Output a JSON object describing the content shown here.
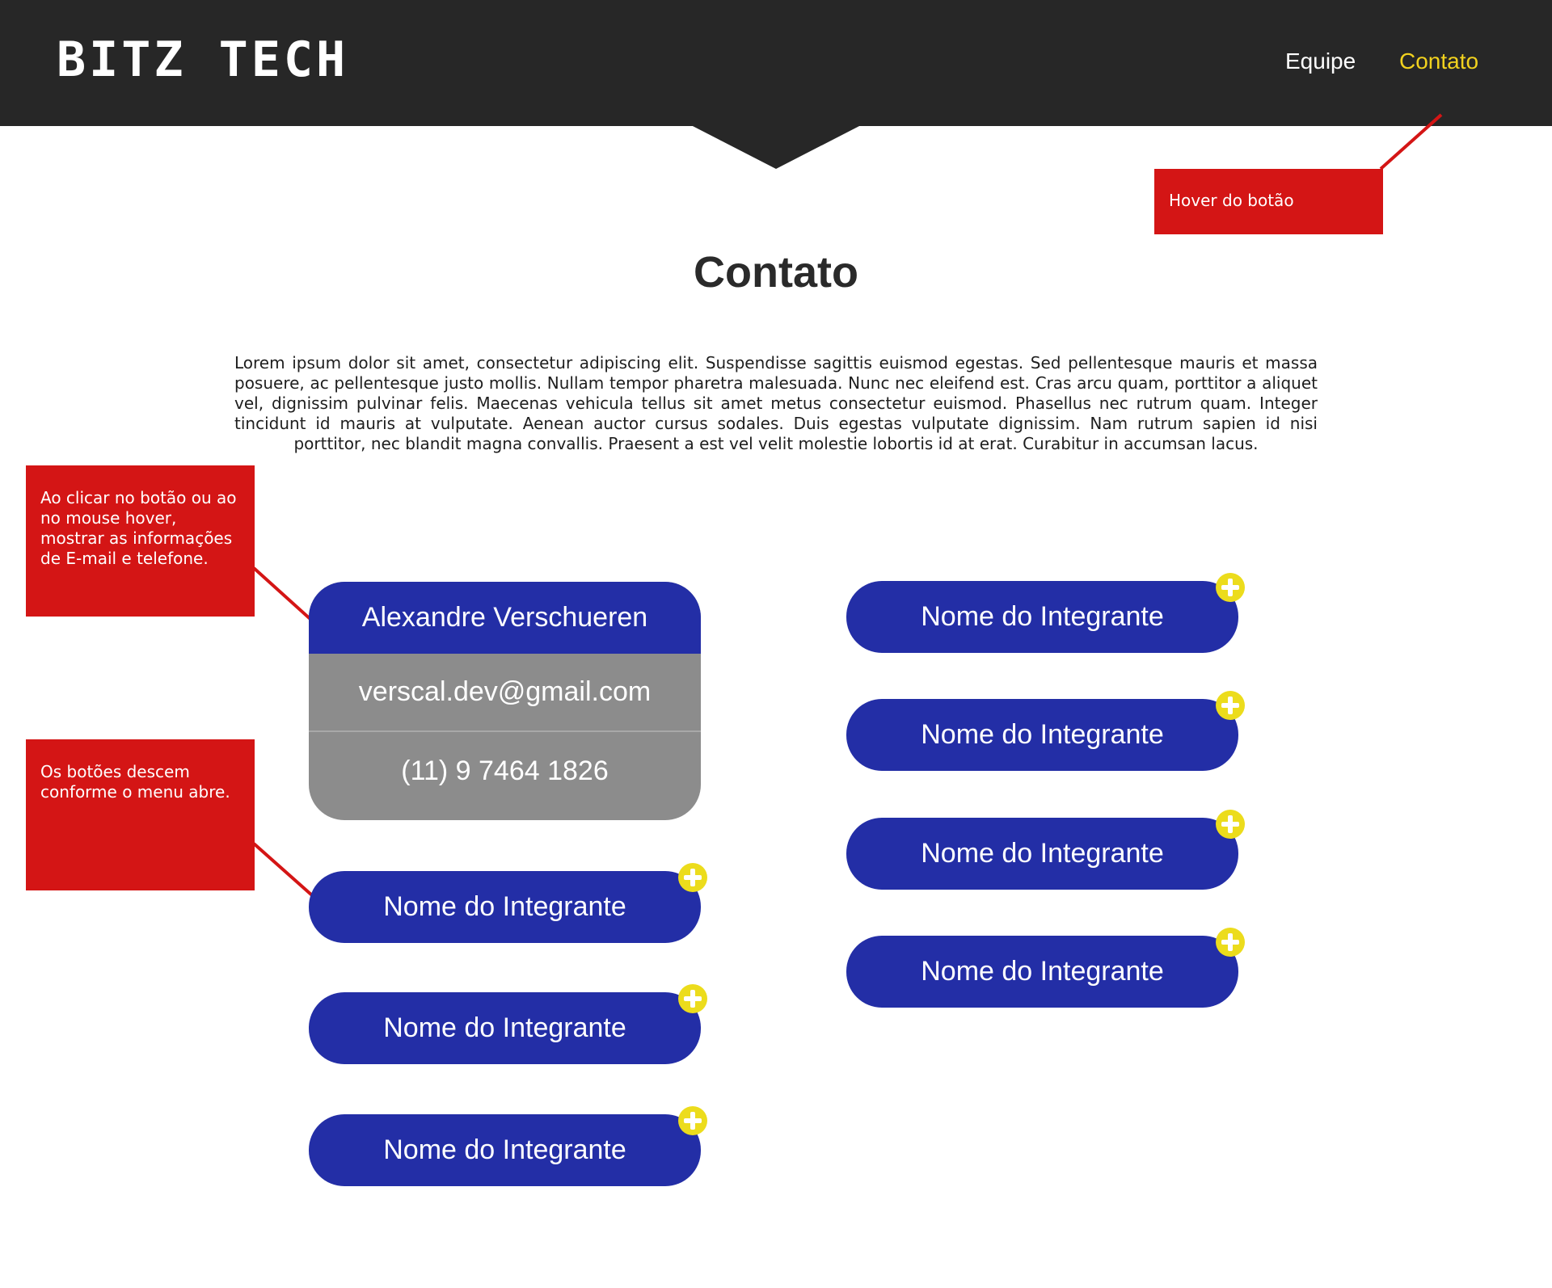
{
  "header": {
    "logo": "BITZ TECH",
    "nav": [
      "Equipe",
      "Contato"
    ]
  },
  "main": {
    "title": "Contato",
    "intro": "Lorem ipsum dolor sit amet, consectetur adipiscing elit. Suspendisse sagittis euismod egestas. Sed pellentesque mauris et massa posuere, ac pellentesque justo mollis. Nullam tempor pharetra malesuada. Nunc nec eleifend est. Cras arcu quam, porttitor a aliquet vel, dignissim pulvinar felis. Maecenas vehicula tellus sit amet metus consectetur euismod. Phasellus nec rutrum quam. Integer tincidunt id mauris at vulputate. Aenean auctor cursus sodales. Duis egestas vulputate dignissim. Nam rutrum sapien id nisi porttitor, nec blandit magna convallis. Praesent a est vel velit molestie lobortis id at erat. Curabitur in accumsan lacus."
  },
  "expanded_card": {
    "name": "Alexandre Verschueren",
    "email": "verscal.dev@gmail.com",
    "phone": "(11) 9 7464 1826"
  },
  "members": {
    "left": [
      "Nome do Integrante",
      "Nome do Integrante",
      "Nome do Integrante"
    ],
    "right": [
      "Nome do Integrante",
      "Nome do Integrante",
      "Nome do Integrante",
      "Nome do Integrante"
    ]
  },
  "annotations": {
    "hover": "Hover do botão",
    "click": "Ao clicar no botão ou ao no mouse hover, mostrar as informações de E-mail e telefone.",
    "descend": "Os botões descem conforme o menu abre."
  },
  "colors": {
    "header_bg": "#272727",
    "nav_active": "#f2d21e",
    "button_blue": "#232ea6",
    "card_gray": "#8c8c8c",
    "plus_yellow": "#ecdc1c",
    "annotation_red": "#d41515"
  },
  "icons": {
    "member_badge": "plus-icon"
  }
}
